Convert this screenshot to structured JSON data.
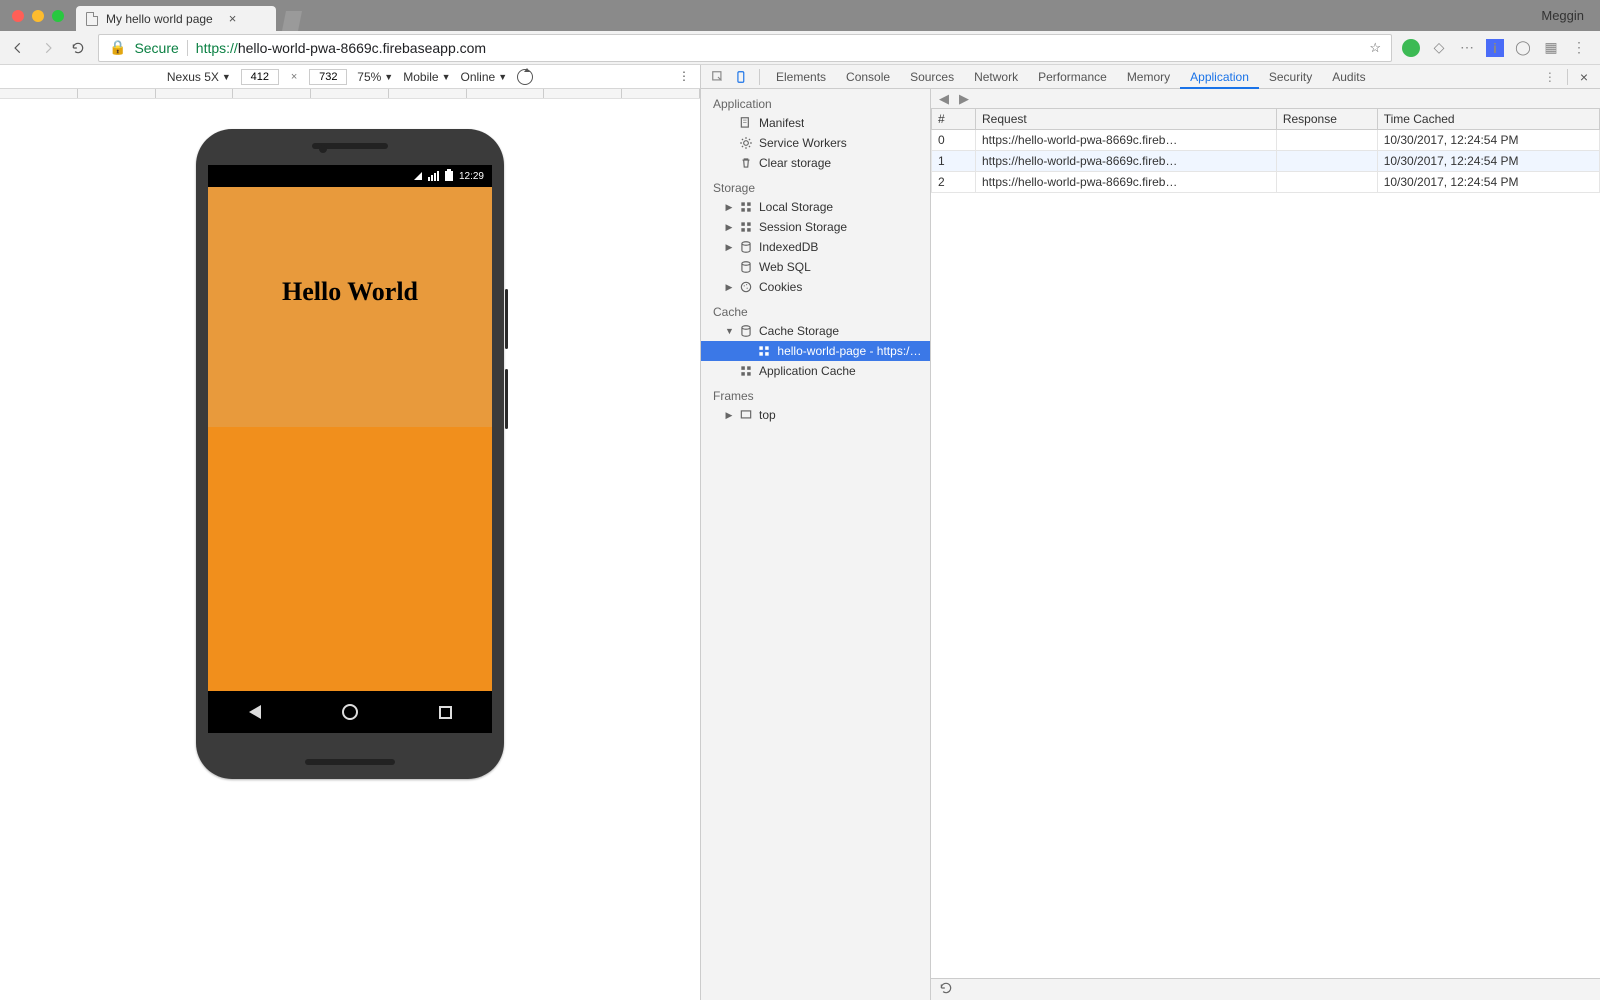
{
  "window": {
    "user": "Meggin"
  },
  "tab": {
    "title": "My hello world page"
  },
  "address": {
    "secure_label": "Secure",
    "protocol": "https://",
    "url_rest": "hello-world-pwa-8669c.firebaseapp.com"
  },
  "device_toolbar": {
    "device": "Nexus 5X",
    "width": "412",
    "height": "732",
    "zoom": "75%",
    "throttle": "Mobile",
    "network": "Online"
  },
  "phone": {
    "time": "12:29",
    "heading": "Hello World"
  },
  "devtools": {
    "tabs": [
      "Elements",
      "Console",
      "Sources",
      "Network",
      "Performance",
      "Memory",
      "Application",
      "Security",
      "Audits"
    ],
    "active_tab_index": 6,
    "sidebar": {
      "application": {
        "label": "Application",
        "items": [
          {
            "label": "Manifest",
            "icon": "manifest"
          },
          {
            "label": "Service Workers",
            "icon": "gear"
          },
          {
            "label": "Clear storage",
            "icon": "trash"
          }
        ]
      },
      "storage": {
        "label": "Storage",
        "items": [
          {
            "label": "Local Storage",
            "icon": "grid",
            "expandable": true
          },
          {
            "label": "Session Storage",
            "icon": "grid",
            "expandable": true
          },
          {
            "label": "IndexedDB",
            "icon": "db",
            "expandable": true
          },
          {
            "label": "Web SQL",
            "icon": "db",
            "expandable": false
          },
          {
            "label": "Cookies",
            "icon": "cookie",
            "expandable": true
          }
        ]
      },
      "cache": {
        "label": "Cache",
        "items": [
          {
            "label": "Cache Storage",
            "icon": "db",
            "expandable": true,
            "expanded": true
          },
          {
            "label": "hello-world-page - https://hello-wo",
            "icon": "grid",
            "nested": true,
            "selected": true
          },
          {
            "label": "Application Cache",
            "icon": "grid",
            "expandable": false
          }
        ]
      },
      "frames": {
        "label": "Frames",
        "items": [
          {
            "label": "top",
            "icon": "frame",
            "expandable": true
          }
        ]
      }
    },
    "table": {
      "headers": [
        "#",
        "Request",
        "Response",
        "Time Cached"
      ],
      "rows": [
        {
          "n": "0",
          "req": "https://hello-world-pwa-8669c.fireb…",
          "res": "",
          "time": "10/30/2017, 12:24:54 PM"
        },
        {
          "n": "1",
          "req": "https://hello-world-pwa-8669c.fireb…",
          "res": "",
          "time": "10/30/2017, 12:24:54 PM"
        },
        {
          "n": "2",
          "req": "https://hello-world-pwa-8669c.fireb…",
          "res": "",
          "time": "10/30/2017, 12:24:54 PM"
        }
      ]
    }
  }
}
